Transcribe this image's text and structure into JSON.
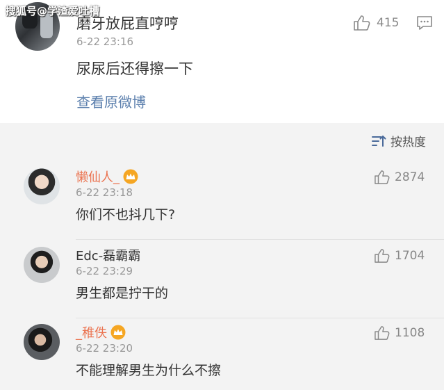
{
  "watermark": "搜狐号@学渣爱吐槽",
  "post": {
    "username": "磨牙放屁直哼哼",
    "time": "6-22 23:16",
    "text": "尿尿后还得擦一下",
    "likes": "415",
    "view_original": "查看原微博"
  },
  "sort": {
    "label": "按热度"
  },
  "comments": [
    {
      "username": "懒仙人_",
      "time": "6-22 23:18",
      "text": "你们不也抖几下?",
      "likes": "2874",
      "vip": true
    },
    {
      "username": "Edc-磊霸霸",
      "time": "6-22 23:29",
      "text": "男生都是拧干的",
      "likes": "1704",
      "vip": false
    },
    {
      "username": "_稚佚",
      "time": "6-22 23:20",
      "text": "不能理解男生为什么不擦",
      "likes": "1108",
      "vip": true
    }
  ],
  "colors": {
    "accent_orange": "#eb7350",
    "link_blue": "#5b7fad",
    "vip_gold": "#f5a623"
  }
}
